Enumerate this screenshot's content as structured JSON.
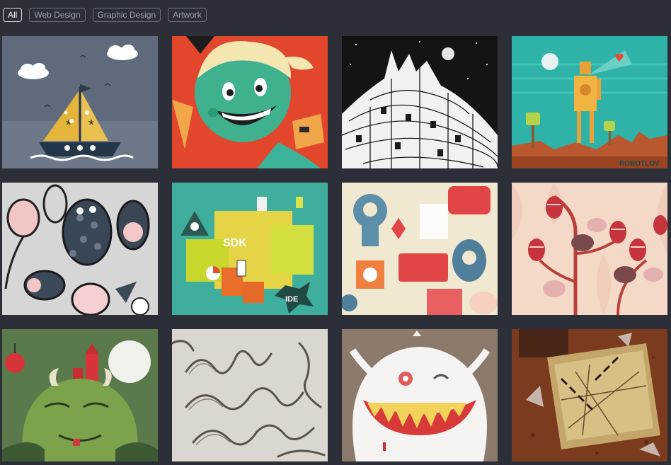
{
  "filters": [
    {
      "label": "All",
      "active": true
    },
    {
      "label": "Web Design",
      "active": false
    },
    {
      "label": "Graphic Design",
      "active": false
    },
    {
      "label": "Artwork",
      "active": false
    }
  ],
  "tiles": [
    {
      "art": "sailboat-clouds",
      "background": "#5f6b7c"
    },
    {
      "art": "smiling-girl-ice-cream",
      "background": "#e2462d"
    },
    {
      "art": "ink-city-hill",
      "background": "#1a1a1a"
    },
    {
      "art": "robot-with-flower",
      "background": "#2fb3a8",
      "signature": "ROBOTLOV"
    },
    {
      "art": "doodle-monsters",
      "background": "#d6d6d6"
    },
    {
      "art": "sdk-machine",
      "background": "#3fae9c",
      "labels": [
        "SDK",
        "IDE"
      ]
    },
    {
      "art": "robot-pattern",
      "background": "#f1e8d2"
    },
    {
      "art": "birds-and-eggs-tree",
      "background": "#f5d9c8"
    },
    {
      "art": "green-monster-castle",
      "background": "#5b7a4c"
    },
    {
      "art": "ribbon-lettering",
      "background": "#d9d7cf"
    },
    {
      "art": "white-monster-teeth",
      "background": "#8c7a6c"
    },
    {
      "art": "broken-glass-table",
      "background": "#7a3b1e"
    }
  ]
}
